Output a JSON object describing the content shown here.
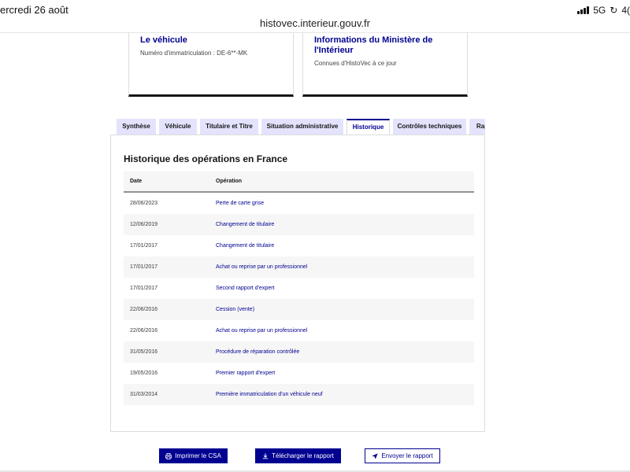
{
  "status_bar": {
    "date": "ercredi 26 août",
    "network": "5G",
    "battery": "4("
  },
  "browser": {
    "url": "histovec.interieur.gouv.fr"
  },
  "cards": [
    {
      "title": "Le véhicule",
      "subtitle": "Numéro d'immatriculation : DE-6**-MK"
    },
    {
      "title": "Informations du Ministère de l'Intérieur",
      "subtitle": "Connues d'HistoVec à ce jour"
    }
  ],
  "tabs": [
    {
      "label": "Synthèse",
      "active": false
    },
    {
      "label": "Véhicule",
      "active": false
    },
    {
      "label": "Titulaire et Titre",
      "active": false
    },
    {
      "label": "Situation administrative",
      "active": false
    },
    {
      "label": "Historique",
      "active": true
    },
    {
      "label": "Contrôles techniques",
      "active": false
    },
    {
      "label": "Rapport",
      "active": false
    }
  ],
  "history": {
    "title": "Historique des opérations en France",
    "columns": [
      "Date",
      "Opération"
    ],
    "rows": [
      {
        "date": "28/06/2023",
        "operation": "Perte de carte grise"
      },
      {
        "date": "12/06/2019",
        "operation": "Changement de titulaire"
      },
      {
        "date": "17/01/2017",
        "operation": "Changement de titulaire"
      },
      {
        "date": "17/01/2017",
        "operation": "Achat ou reprise par un professionnel"
      },
      {
        "date": "17/01/2017",
        "operation": "Second rapport d'expert"
      },
      {
        "date": "22/06/2016",
        "operation": "Cession (vente)"
      },
      {
        "date": "22/06/2016",
        "operation": "Achat ou reprise par un professionnel"
      },
      {
        "date": "31/05/2016",
        "operation": "Procédure de réparation contrôlée"
      },
      {
        "date": "19/05/2016",
        "operation": "Premier rapport d'expert"
      },
      {
        "date": "31/03/2014",
        "operation": "Première immatriculation d'un véhicule neuf"
      }
    ]
  },
  "actions": {
    "print_label": "Imprimer le CSA",
    "download_label": "Télécharger le rapport",
    "send_label": "Envoyer le rapport"
  },
  "icons": {
    "print": "printer-icon",
    "download": "download-icon",
    "send": "send-icon"
  },
  "colors": {
    "primary": "#000091",
    "tab_bg": "#e3e3fd",
    "row_alt": "#f6f6f6"
  }
}
